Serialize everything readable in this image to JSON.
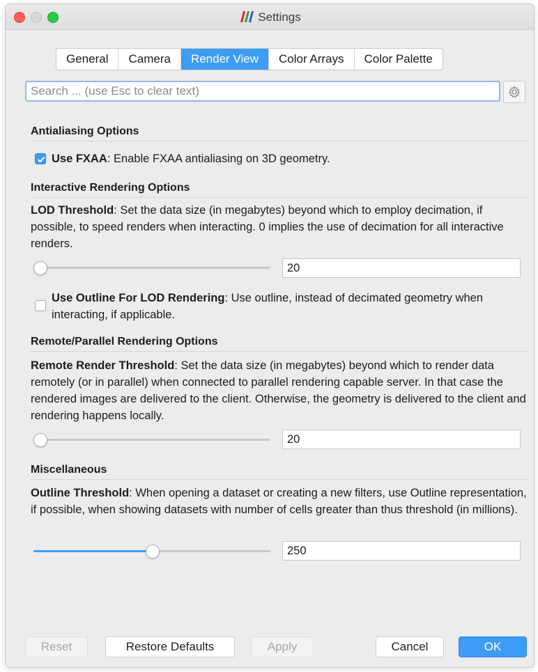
{
  "window": {
    "title": "Settings"
  },
  "tabs": [
    {
      "label": "General"
    },
    {
      "label": "Camera"
    },
    {
      "label": "Render View"
    },
    {
      "label": "Color Arrays"
    },
    {
      "label": "Color Palette"
    }
  ],
  "active_tab": "Render View",
  "search": {
    "placeholder": "Search ... (use Esc to clear text)",
    "value": ""
  },
  "sections": {
    "antialiasing": {
      "title": "Antialiasing Options",
      "use_fxaa": {
        "name": "Use FXAA",
        "desc": ": Enable FXAA antialiasing on 3D geometry.",
        "checked": true
      }
    },
    "interactive": {
      "title": "Interactive Rendering Options",
      "lod_threshold": {
        "name": "LOD Threshold",
        "desc": ": Set the data size (in megabytes) beyond which to employ decimation, if possible, to speed renders when interacting. 0 implies the use of decimation for all interactive renders.",
        "value": "20",
        "slider_fraction": 0.0
      },
      "use_outline": {
        "name": "Use Outline For LOD Rendering",
        "desc": ": Use outline, instead of decimated geometry when interacting, if applicable.",
        "checked": false
      }
    },
    "remote": {
      "title": "Remote/Parallel Rendering Options",
      "remote_threshold": {
        "name": "Remote Render Threshold",
        "desc": ": Set the data size (in megabytes) beyond which to render data remotely (or in parallel) when connected to parallel rendering capable server. In that case the rendered images are delivered to the client. Otherwise, the geometry is delivered to the client and rendering happens locally.",
        "value": "20",
        "slider_fraction": 0.0
      }
    },
    "misc": {
      "title": "Miscellaneous",
      "outline_threshold": {
        "name": "Outline Threshold",
        "desc": ": When opening a dataset or creating a new filters, use Outline representation, if possible, when showing datasets with number of cells greater than thus threshold (in millions).",
        "value": "250",
        "slider_fraction": 0.5
      }
    }
  },
  "buttons": {
    "reset": "Reset",
    "restore_defaults": "Restore Defaults",
    "apply": "Apply",
    "cancel": "Cancel",
    "ok": "OK"
  },
  "colors": {
    "accent": "#3d9cf5",
    "window_bg": "#ececec"
  },
  "icons": {
    "search_options": "gear-icon",
    "app": "paraview-logo-icon"
  }
}
